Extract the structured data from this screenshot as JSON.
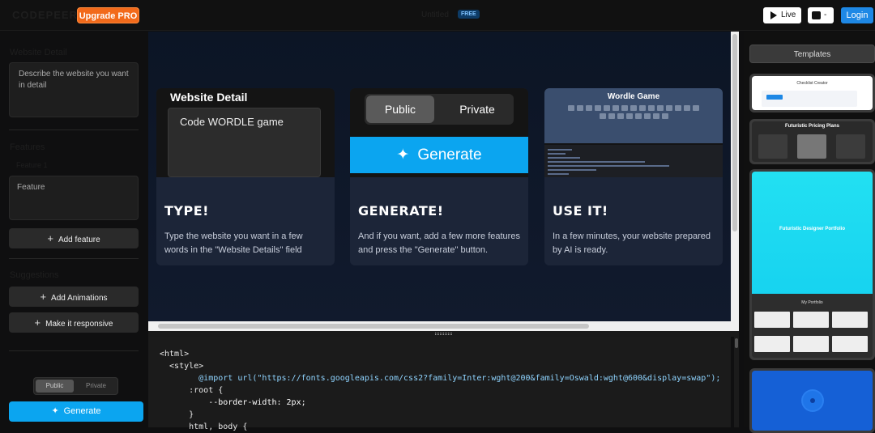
{
  "topbar": {
    "logo": "CODEPEER",
    "upgrade_label": "Upgrade PRO",
    "doc_title": "Untitled",
    "free_badge": "FREE",
    "live_label": "Live",
    "share_label": "-",
    "login_label": "Login"
  },
  "sidebar": {
    "website_detail_label": "Website Detail",
    "website_detail_placeholder": "Describe the website you want in detail",
    "features_label": "Features",
    "feature_1_label": "Feature 1",
    "feature_placeholder": "Feature",
    "add_feature_label": "Add feature",
    "suggestions_label": "Suggestions",
    "suggestions": [
      "Add Animations",
      "Make it responsive"
    ],
    "visibility_public": "Public",
    "visibility_private": "Private",
    "generate_label": "Generate"
  },
  "preview": {
    "cards": [
      {
        "art_title": "Website Detail",
        "art_text": "Code WORDLE game",
        "heading": "TYPE!",
        "body": "Type the website you want in a few words in the \"Website Details\" field"
      },
      {
        "art_public": "Public",
        "art_private": "Private",
        "art_generate": "Generate",
        "heading": "GENERATE!",
        "body": "And if you want, add a few more features and press the \"Generate\" button."
      },
      {
        "art_title": "Wordle Game",
        "heading": "USE IT!",
        "body": "In a few minutes, your website prepared by AI is ready."
      }
    ]
  },
  "code": {
    "lines": [
      "<html>",
      "  <style>",
      "        @import url(\"https://fonts.googleapis.com/css2?family=Inter:wght@200&family=Oswald:wght@600&display=swap\");",
      "      :root {",
      "          --border-width: 2px;",
      "      }",
      "      html, body {"
    ]
  },
  "templates": {
    "header": "Templates",
    "items": [
      {
        "title": "Checklist Creator"
      },
      {
        "title": "Futuristic Pricing Plans",
        "plans": [
          "Basic Plan",
          "Pro Plan",
          "Enterprise Plan"
        ],
        "prices": [
          "$9",
          "$29",
          "$99"
        ]
      },
      {
        "title": "Futuristic Designer Portfolio",
        "subtitle": "My Portfolio"
      },
      {
        "title": ""
      }
    ]
  },
  "colors": {
    "accent": "#0ba5f0",
    "upgrade": "#f26a1b",
    "login": "#1e88e5"
  }
}
